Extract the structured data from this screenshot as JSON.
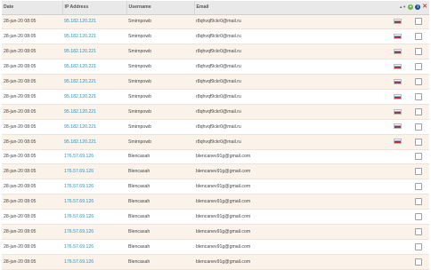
{
  "columns": {
    "date": "Date",
    "ip": "IP Address",
    "username": "Username",
    "email": "Email"
  },
  "header_icons": [
    "sort-icon",
    "add-icon",
    "info-icon",
    "close-icon"
  ],
  "rows": [
    {
      "date": "28-jun-20 08:05",
      "ip": "95.182.120.221",
      "username": "Smirnpowb",
      "email": "r8qhvqf9ckr0@mail.ru",
      "flag": "ru"
    },
    {
      "date": "28-jun-20 08:05",
      "ip": "95.182.120.221",
      "username": "Smirnpowb",
      "email": "r8qhvqf9ckr0@mail.ru",
      "flag": "ru"
    },
    {
      "date": "28-jun-20 08:05",
      "ip": "95.182.120.221",
      "username": "Smirnpowb",
      "email": "r8qhvqf9ckr0@mail.ru",
      "flag": "ru"
    },
    {
      "date": "28-jun-20 08:05",
      "ip": "95.182.120.221",
      "username": "Smirnpowb",
      "email": "r8qhvqf9ckr0@mail.ru",
      "flag": "ru"
    },
    {
      "date": "28-jun-20 08:05",
      "ip": "95.182.120.221",
      "username": "Smirnpowb",
      "email": "r8qhvqf9ckr0@mail.ru",
      "flag": "ru"
    },
    {
      "date": "28-jun-20 08:05",
      "ip": "95.182.120.221",
      "username": "Smirnpowb",
      "email": "r8qhvqf9ckr0@mail.ru",
      "flag": "ru"
    },
    {
      "date": "28-jun-20 08:05",
      "ip": "95.182.120.221",
      "username": "Smirnpowb",
      "email": "r8qhvqf9ckr0@mail.ru",
      "flag": "ru"
    },
    {
      "date": "28-jun-20 08:05",
      "ip": "95.182.120.221",
      "username": "Smirnpowb",
      "email": "r8qhvqf9ckr0@mail.ru",
      "flag": "ru"
    },
    {
      "date": "28-jun-20 08:05",
      "ip": "95.182.120.221",
      "username": "Smirnpowb",
      "email": "r8qhvqf9ckr0@mail.ru",
      "flag": "ru"
    },
    {
      "date": "28-jun-20 08:05",
      "ip": "176.57.69.126",
      "username": "Blencasah",
      "email": "blencanev91g@gmail.com",
      "flag": ""
    },
    {
      "date": "28-jun-20 08:05",
      "ip": "176.57.69.126",
      "username": "Blencasah",
      "email": "blencanev91g@gmail.com",
      "flag": ""
    },
    {
      "date": "28-jun-20 08:05",
      "ip": "176.57.69.126",
      "username": "Blencasah",
      "email": "blencanev91g@gmail.com",
      "flag": ""
    },
    {
      "date": "28-jun-20 08:05",
      "ip": "176.57.69.126",
      "username": "Blencasah",
      "email": "blencanev91g@gmail.com",
      "flag": ""
    },
    {
      "date": "28-jun-20 08:05",
      "ip": "176.57.69.126",
      "username": "Blencasah",
      "email": "blencanev91g@gmail.com",
      "flag": ""
    },
    {
      "date": "28-jun-20 08:05",
      "ip": "176.57.69.126",
      "username": "Blencasah",
      "email": "blencanev91g@gmail.com",
      "flag": ""
    },
    {
      "date": "28-jun-20 08:05",
      "ip": "176.57.69.126",
      "username": "Blencasah",
      "email": "blencanev91g@gmail.com",
      "flag": ""
    },
    {
      "date": "28-jun-20 08:05",
      "ip": "176.57.69.126",
      "username": "Blencasah",
      "email": "blencanev91g@gmail.com",
      "flag": ""
    }
  ],
  "colors": {
    "header_bg": "#e9e9e9",
    "row_alt_bg": "#fbf2ea",
    "ip_link": "#2c8fb8",
    "add_green": "#6ab04c",
    "info_navy": "#1d4e89",
    "close_red": "#d63b2e"
  }
}
